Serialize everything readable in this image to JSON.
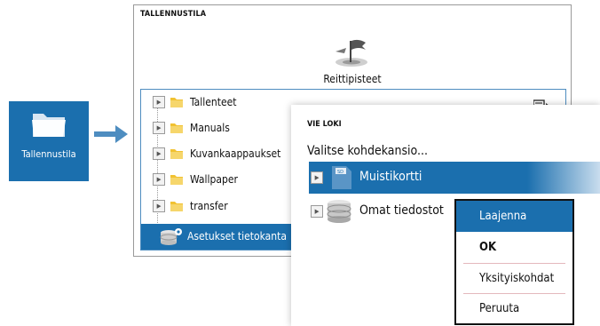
{
  "tile": {
    "label": "Tallennustila",
    "icon": "folder-icon"
  },
  "storage_window": {
    "title": "TALLENNUSTILA",
    "waypoints_label": "Reittipisteet",
    "folders": [
      {
        "name": "Tallenteet"
      },
      {
        "name": "Manuals"
      },
      {
        "name": "Kuvankaappaukset"
      },
      {
        "name": "Wallpaper"
      },
      {
        "name": "transfer"
      }
    ],
    "database_label": "Asetukset tietokanta"
  },
  "export_dialog": {
    "title": "VIE LOKI",
    "subtitle": "Valitse kohdekansio...",
    "items": [
      {
        "label": "Muistikortti",
        "selected": true,
        "icon": "sd-card-icon"
      },
      {
        "label": "Omat tiedostot",
        "selected": false,
        "icon": "database-icon"
      }
    ]
  },
  "context_menu": {
    "items": [
      {
        "label": "Laajenna",
        "active": true
      },
      {
        "label": "OK",
        "bold": true
      },
      {
        "label": "Yksityiskohdat"
      },
      {
        "label": "Peruuta"
      }
    ]
  },
  "colors": {
    "accent": "#1b6fae",
    "folder": "#f1c232",
    "border": "#9a9a9a"
  }
}
